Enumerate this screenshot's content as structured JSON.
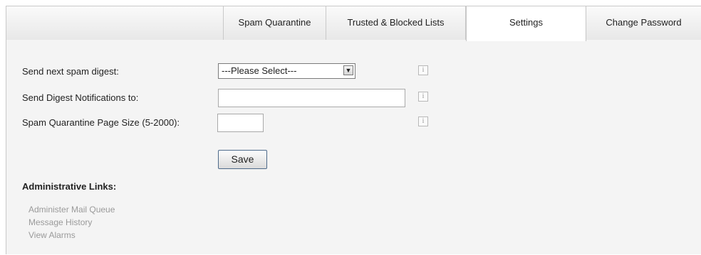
{
  "tabs": [
    {
      "label": "Spam Quarantine",
      "active": false
    },
    {
      "label": "Trusted & Blocked Lists",
      "active": false
    },
    {
      "label": "Settings",
      "active": true
    },
    {
      "label": "Change Password",
      "active": false
    }
  ],
  "form": {
    "digest_label": "Send next spam digest:",
    "digest_select_value": "---Please Select---",
    "notify_label": "Send Digest Notifications to:",
    "notify_value": "",
    "pagesize_label": "Spam Quarantine Page Size (5-2000):",
    "pagesize_value": "",
    "info_glyph": "i",
    "save_label": "Save"
  },
  "admin": {
    "heading": "Administrative Links:",
    "links": [
      "Administer Mail Queue",
      "Message History",
      "View Alarms"
    ]
  },
  "icons": {
    "info": "info-icon",
    "dropdown": "chevron-down-icon"
  },
  "colors": {
    "link": "#9a9a9a",
    "save_border": "#4e6a8a"
  }
}
